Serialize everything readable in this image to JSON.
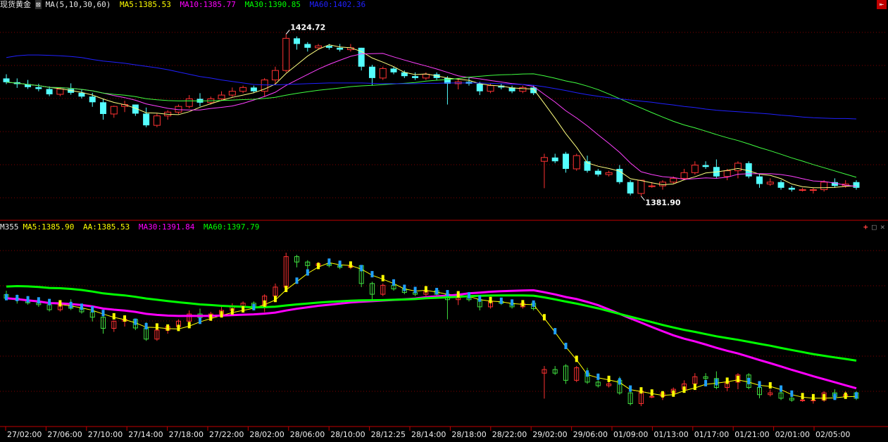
{
  "header": {
    "instrument": "现货黄金",
    "indicator_label": "MA(5,10,30,60)",
    "ma5": "MA5:1385.53",
    "ma10": "MA10:1385.77",
    "ma30": "MA30:1390.85",
    "ma60": "MA60:1402.36",
    "high_mark": "1424.72",
    "low_mark": "1381.90"
  },
  "sub_header": {
    "name": "M355",
    "ma5": "MA5:1385.90",
    "aa": "AA:1385.53",
    "ma30": "MA30:1391.84",
    "ma60": "MA60:1397.79"
  },
  "colors": {
    "up": "#ff3232",
    "down": "#54ffff",
    "ma5": "#ffffff",
    "ma10": "#ffff00",
    "ma30": "#ff00ff",
    "ma60": "#00cc00",
    "ma60_blue": "#2020ff",
    "grid": "#800000"
  },
  "icons": {
    "exit": "exit-icon",
    "add": "plus-icon",
    "restore": "restore-icon",
    "close": "close-icon"
  },
  "chart_data": {
    "type": "candlestick",
    "price_range": [
      1377,
      1430
    ],
    "x_labels": [
      "27/02:00",
      "27/06:00",
      "27/10:00",
      "27/14:00",
      "27/18:00",
      "27/22:00",
      "28/02:00",
      "28/06:00",
      "28/10:00",
      "28/12:25",
      "28/14:00",
      "28/18:00",
      "28/22:00",
      "29/02:00",
      "29/06:00",
      "01/09:00",
      "01/13:00",
      "01/17:00",
      "01/21:00",
      "02/01:00",
      "02/05:00"
    ],
    "candles": [
      [
        1413.0,
        1414.1,
        1411.5,
        1412.0
      ],
      [
        1412.0,
        1413.0,
        1410.5,
        1411.5
      ],
      [
        1411.5,
        1412.6,
        1410.2,
        1410.7
      ],
      [
        1410.7,
        1411.6,
        1409.6,
        1410.2
      ],
      [
        1410.2,
        1410.9,
        1408.3,
        1408.8
      ],
      [
        1408.8,
        1410.7,
        1408.3,
        1410.2
      ],
      [
        1410.2,
        1411.7,
        1408.7,
        1409.2
      ],
      [
        1409.2,
        1410.2,
        1407.7,
        1408.2
      ],
      [
        1408.2,
        1409.2,
        1405.5,
        1406.7
      ],
      [
        1406.7,
        1407.7,
        1402.1,
        1403.6
      ],
      [
        1403.6,
        1405.8,
        1402.6,
        1405.6
      ],
      [
        1405.6,
        1407.1,
        1404.1,
        1406.1
      ],
      [
        1406.1,
        1406.1,
        1403.1,
        1403.7
      ],
      [
        1403.7,
        1405.3,
        1400.1,
        1400.6
      ],
      [
        1400.6,
        1403.7,
        1400.1,
        1403.1
      ],
      [
        1403.1,
        1404.6,
        1402.1,
        1404.1
      ],
      [
        1404.1,
        1406.1,
        1403.6,
        1405.6
      ],
      [
        1405.6,
        1408.6,
        1405.1,
        1407.6
      ],
      [
        1407.6,
        1409.1,
        1405.6,
        1406.6
      ],
      [
        1406.6,
        1408.2,
        1406.1,
        1407.6
      ],
      [
        1407.6,
        1409.6,
        1407.1,
        1408.6
      ],
      [
        1408.6,
        1410.6,
        1408.1,
        1409.6
      ],
      [
        1409.6,
        1411.1,
        1409.1,
        1410.6
      ],
      [
        1410.6,
        1411.1,
        1409.1,
        1409.6
      ],
      [
        1409.6,
        1413.1,
        1408.1,
        1412.6
      ],
      [
        1412.6,
        1416.1,
        1411.6,
        1415.1
      ],
      [
        1415.1,
        1424.7,
        1414.6,
        1423.6
      ],
      [
        1423.6,
        1424.1,
        1420.6,
        1422.1
      ],
      [
        1422.1,
        1422.6,
        1420.1,
        1421.1
      ],
      [
        1421.1,
        1422.1,
        1420.6,
        1421.6
      ],
      [
        1421.6,
        1422.1,
        1420.6,
        1421.1
      ],
      [
        1421.1,
        1422.1,
        1420.1,
        1420.6
      ],
      [
        1420.6,
        1422.1,
        1420.1,
        1421.1
      ],
      [
        1421.1,
        1421.1,
        1415.1,
        1416.1
      ],
      [
        1416.1,
        1416.6,
        1411.1,
        1413.1
      ],
      [
        1413.1,
        1416.1,
        1412.6,
        1415.6
      ],
      [
        1415.6,
        1416.1,
        1414.1,
        1414.6
      ],
      [
        1414.6,
        1415.1,
        1413.1,
        1413.6
      ],
      [
        1413.6,
        1414.6,
        1412.6,
        1413.1
      ],
      [
        1413.1,
        1414.6,
        1412.6,
        1414.1
      ],
      [
        1414.1,
        1414.6,
        1412.6,
        1413.1
      ],
      [
        1413.1,
        1413.6,
        1406.1,
        1411.6
      ],
      [
        1411.6,
        1413.1,
        1410.1,
        1412.1
      ],
      [
        1412.1,
        1413.1,
        1411.1,
        1411.6
      ],
      [
        1411.6,
        1412.1,
        1408.6,
        1409.6
      ],
      [
        1409.6,
        1411.6,
        1409.1,
        1411.1
      ],
      [
        1411.1,
        1411.6,
        1410.1,
        1410.6
      ],
      [
        1410.6,
        1411.1,
        1409.1,
        1409.6
      ],
      [
        1409.6,
        1411.1,
        1409.1,
        1410.6
      ],
      [
        1410.6,
        1411.1,
        1408.6,
        1409.1
      ],
      [
        1391.1,
        1393.1,
        1384.0,
        1392.1
      ],
      [
        1392.1,
        1393.1,
        1390.6,
        1391.1
      ],
      [
        1393.1,
        1393.6,
        1388.1,
        1389.1
      ],
      [
        1389.1,
        1393.1,
        1388.6,
        1392.6
      ],
      [
        1391.1,
        1392.6,
        1388.1,
        1388.6
      ],
      [
        1388.6,
        1389.1,
        1387.1,
        1387.6
      ],
      [
        1387.6,
        1388.6,
        1387.1,
        1388.1
      ],
      [
        1389.1,
        1390.1,
        1385.1,
        1385.6
      ],
      [
        1385.6,
        1386.1,
        1382.1,
        1382.6
      ],
      [
        1382.6,
        1386.1,
        1381.9,
        1386.1
      ],
      [
        1384.6,
        1385.6,
        1384.1,
        1384.6
      ],
      [
        1384.6,
        1386.1,
        1383.6,
        1385.6
      ],
      [
        1385.6,
        1387.1,
        1385.1,
        1386.6
      ],
      [
        1386.6,
        1389.1,
        1386.1,
        1388.1
      ],
      [
        1388.1,
        1391.1,
        1387.6,
        1390.1
      ],
      [
        1390.1,
        1391.1,
        1389.1,
        1389.6
      ],
      [
        1389.6,
        1391.6,
        1386.6,
        1387.1
      ],
      [
        1387.1,
        1389.1,
        1386.1,
        1388.6
      ],
      [
        1388.6,
        1391.1,
        1386.6,
        1390.6
      ],
      [
        1390.6,
        1391.1,
        1386.6,
        1387.1
      ],
      [
        1387.1,
        1387.6,
        1384.1,
        1385.1
      ],
      [
        1385.1,
        1386.6,
        1384.6,
        1385.6
      ],
      [
        1385.6,
        1386.1,
        1383.6,
        1384.1
      ],
      [
        1384.1,
        1384.6,
        1383.1,
        1383.6
      ],
      [
        1383.6,
        1384.1,
        1383.1,
        1383.6
      ],
      [
        1383.6,
        1384.1,
        1382.6,
        1383.6
      ],
      [
        1383.6,
        1386.1,
        1383.1,
        1385.6
      ],
      [
        1385.6,
        1386.6,
        1384.1,
        1384.6
      ],
      [
        1384.6,
        1386.1,
        1384.1,
        1385.1
      ],
      [
        1385.6,
        1386.1,
        1383.6,
        1384.1
      ]
    ],
    "ma60_values_top": [
      1418.5,
      1419,
      1419.2,
      1419.2,
      1419.1,
      1419,
      1418.8,
      1418.5,
      1418,
      1417.6,
      1417.3,
      1417,
      1416.6,
      1416.2,
      1415.8,
      1415.3,
      1414.7,
      1414.1,
      1413.5,
      1413.1,
      1412.6,
      1412.2,
      1411.8,
      1411.4,
      1411.3,
      1411.3,
      1411.4,
      1411.5,
      1411.6,
      1411.7,
      1411.8,
      1411.8,
      1411.8,
      1411.8,
      1411.7,
      1411.6,
      1411.6,
      1411.6,
      1411.6,
      1411.7,
      1411.7,
      1411.8,
      1411.8,
      1411.8,
      1411.8,
      1411.7,
      1411.6,
      1411.5,
      1411.4,
      1411.2,
      1410.8,
      1410.3,
      1409.8,
      1409.2,
      1408.7,
      1408.3,
      1407.9,
      1407.6,
      1407.3,
      1407.0,
      1406.7,
      1406.3,
      1406.0,
      1405.6,
      1405.3,
      1404.9,
      1404.6,
      1404.4,
      1404.2,
      1404.0,
      1403.8,
      1403.6,
      1403.3,
      1403.1,
      1402.8,
      1402.6,
      1402.5,
      1402.4,
      1402.4,
      1402.3
    ]
  }
}
